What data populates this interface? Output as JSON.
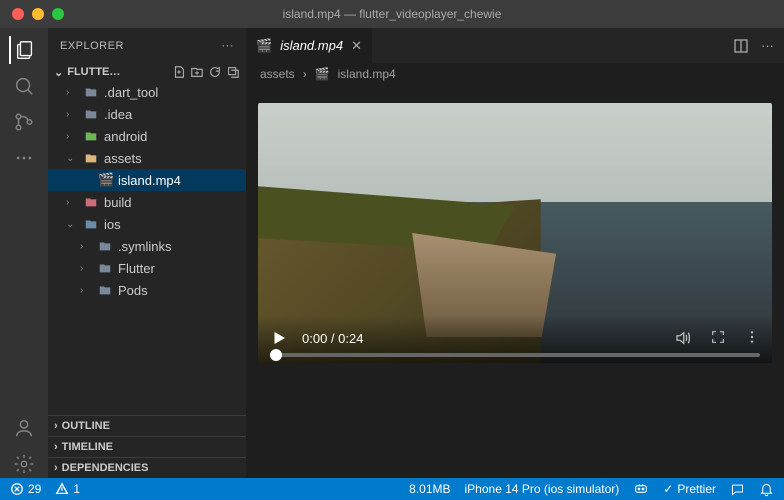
{
  "window": {
    "title": "island.mp4 — flutter_videoplayer_chewie"
  },
  "explorer": {
    "title": "EXPLORER",
    "project_label": "FLUTTE…",
    "tree": [
      {
        "name": ".dart_tool",
        "type": "folder",
        "depth": 1,
        "expanded": false,
        "color": "#7a8899"
      },
      {
        "name": ".idea",
        "type": "folder",
        "depth": 1,
        "expanded": false,
        "color": "#7a8899"
      },
      {
        "name": "android",
        "type": "folder",
        "depth": 1,
        "expanded": false,
        "color": "#70b55a"
      },
      {
        "name": "assets",
        "type": "folder",
        "depth": 1,
        "expanded": true,
        "color": "#dcb67a"
      },
      {
        "name": "island.mp4",
        "type": "file",
        "depth": 2,
        "selected": true,
        "icon": "🎬",
        "color": "#e37933"
      },
      {
        "name": "build",
        "type": "folder",
        "depth": 1,
        "expanded": false,
        "color": "#cc6d7a"
      },
      {
        "name": "ios",
        "type": "folder",
        "depth": 1,
        "expanded": true,
        "color": "#6a8ea8"
      },
      {
        "name": ".symlinks",
        "type": "folder",
        "depth": 2,
        "expanded": false,
        "color": "#7a8899"
      },
      {
        "name": "Flutter",
        "type": "folder",
        "depth": 2,
        "expanded": false,
        "color": "#7a8899"
      },
      {
        "name": "Pods",
        "type": "folder",
        "depth": 2,
        "expanded": false,
        "color": "#7a8899"
      }
    ],
    "sections": [
      "OUTLINE",
      "TIMELINE",
      "DEPENDENCIES"
    ]
  },
  "tab": {
    "icon": "🎬",
    "label": "island.mp4"
  },
  "breadcrumb": {
    "segments": [
      "assets",
      "island.mp4"
    ],
    "icon": "🎬"
  },
  "video": {
    "current": "0:00",
    "total": "0:24"
  },
  "status": {
    "errors": "29",
    "warnings": "1",
    "mem": "8.01MB",
    "device": "iPhone 14 Pro (ios simulator)",
    "formatter": "Prettier"
  }
}
